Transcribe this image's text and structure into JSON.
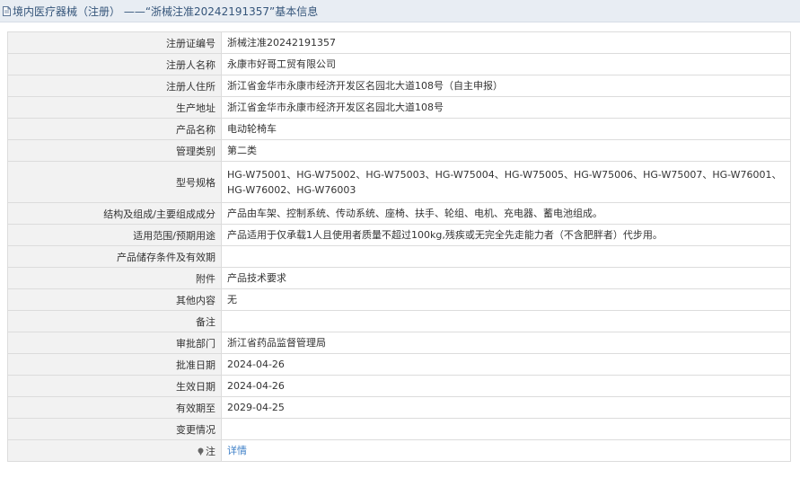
{
  "header": {
    "icon": "document-icon",
    "title": "境内医疗器械（注册） ——“浙械注准20242191357”基本信息"
  },
  "rows": [
    {
      "key": "reg_no",
      "label": "注册证编号",
      "value": "浙械注准20242191357"
    },
    {
      "key": "registrant",
      "label": "注册人名称",
      "value": "永康市好哥工贸有限公司"
    },
    {
      "key": "address",
      "label": "注册人住所",
      "value": "浙江省金华市永康市经济开发区名园北大道108号（自主申报）"
    },
    {
      "key": "production_address",
      "label": "生产地址",
      "value": "浙江省金华市永康市经济开发区名园北大道108号"
    },
    {
      "key": "product_name",
      "label": "产品名称",
      "value": "电动轮椅车"
    },
    {
      "key": "category",
      "label": "管理类别",
      "value": "第二类"
    },
    {
      "key": "model",
      "label": "型号规格",
      "value": "HG-W75001、HG-W75002、HG-W75003、HG-W75004、HG-W75005、HG-W75006、HG-W75007、HG-W76001、HG-W76002、HG-W76003"
    },
    {
      "key": "structure",
      "label": "结构及组成/主要组成成分",
      "value": "产品由车架、控制系统、传动系统、座椅、扶手、轮组、电机、充电器、蓄电池组成。"
    },
    {
      "key": "scope",
      "label": "适用范围/预期用途",
      "value": "产品适用于仅承载1人且使用者质量不超过100kg,残疾或无完全先走能力者（不含肥胖者）代步用。"
    },
    {
      "key": "storage",
      "label": "产品储存条件及有效期",
      "value": ""
    },
    {
      "key": "attachment",
      "label": "附件",
      "value": "产品技术要求"
    },
    {
      "key": "other",
      "label": "其他内容",
      "value": "无"
    },
    {
      "key": "remark",
      "label": "备注",
      "value": ""
    },
    {
      "key": "approval_dept",
      "label": "审批部门",
      "value": "浙江省药品监督管理局"
    },
    {
      "key": "approval_date",
      "label": "批准日期",
      "value": "2024-04-26"
    },
    {
      "key": "effective_date",
      "label": "生效日期",
      "value": "2024-04-26"
    },
    {
      "key": "expiry_date",
      "label": "有效期至",
      "value": "2029-04-25"
    },
    {
      "key": "change",
      "label": "变更情况",
      "value": ""
    }
  ],
  "note_row": {
    "icon": "note-icon",
    "label": "注",
    "link_text": "详情"
  },
  "colors": {
    "title_bar_bg": "#e8edf3",
    "title_text": "#35557a",
    "label_bg": "#f2f2f2",
    "border": "#dcdcdc",
    "link": "#3d7fc7"
  }
}
